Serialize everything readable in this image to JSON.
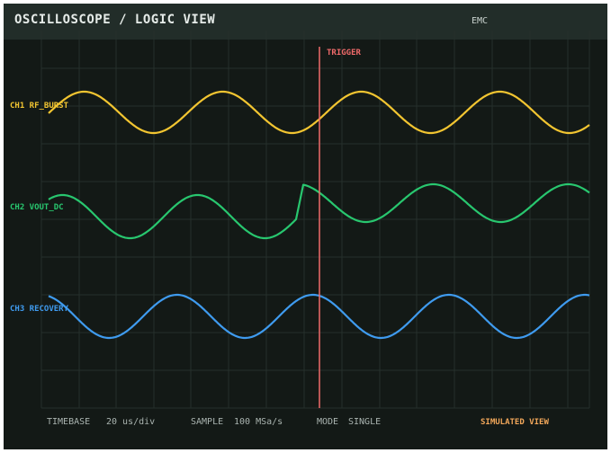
{
  "header": {
    "title": "OSCILLOSCOPE / LOGIC VIEW",
    "badge": "EMC"
  },
  "trigger": {
    "label": "TRIGGER",
    "color": "#ef6a6a"
  },
  "channels": [
    {
      "id": "ch1",
      "label": "CH1 RF_BURST",
      "color": "#f2c531"
    },
    {
      "id": "ch2",
      "label": "CH2 VOUT_DC",
      "color": "#28c76f"
    },
    {
      "id": "ch3",
      "label": "CH3 RECOVERY",
      "color": "#3f9bef"
    }
  ],
  "footer": {
    "timebase_label": "TIMEBASE",
    "timebase_value": "20 us/div",
    "sample_label": "SAMPLE",
    "sample_value": "100 MSa/s",
    "mode_label": "MODE",
    "mode_value": "SINGLE",
    "view_note": "SIMULATED VIEW"
  },
  "colors": {
    "background": "#131916",
    "header": "#222d29",
    "grid": "#26302c"
  }
}
